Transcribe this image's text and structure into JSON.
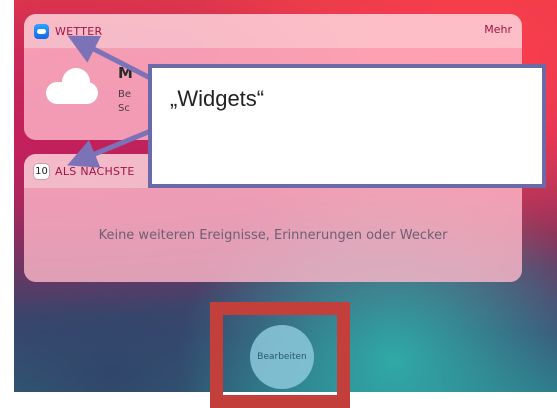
{
  "weather_widget": {
    "app_name": "WETTER",
    "more_label": "Mehr",
    "icon": "weather-app-icon",
    "city_partial": "M",
    "desc_line1_partial": "Be",
    "desc_line2_partial": "Sc"
  },
  "events_widget": {
    "calendar_day": "10",
    "app_name_partial": "ALS NÄCHSTE",
    "empty_text": "Keine weiteren Ereignisse, Erinnerungen oder Wecker"
  },
  "callout": {
    "text": "„Widgets“"
  },
  "edit": {
    "label": "Bearbeiten"
  },
  "colors": {
    "callout_border": "#6a6aa8",
    "highlight_frame": "#c23f3c",
    "arrow": "#7b72b8"
  }
}
